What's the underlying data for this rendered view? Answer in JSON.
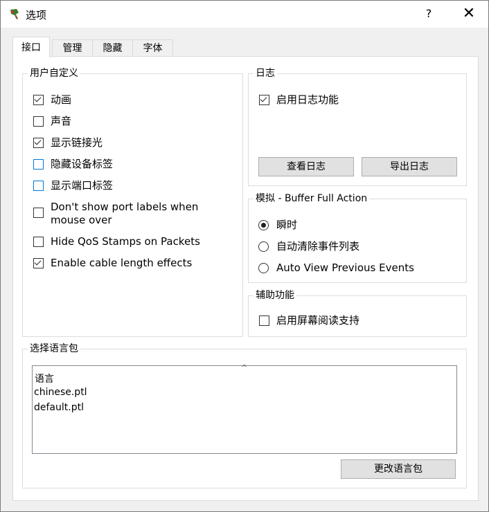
{
  "window": {
    "title": "选项",
    "help_label": "?",
    "close_label": "✕"
  },
  "tabs": [
    {
      "label": "接口",
      "active": true
    },
    {
      "label": "管理",
      "active": false
    },
    {
      "label": "隐藏",
      "active": false
    },
    {
      "label": "字体",
      "active": false
    }
  ],
  "customize": {
    "title": "用户自定义",
    "items": [
      {
        "label": "动画",
        "checked": true
      },
      {
        "label": "声音",
        "checked": false
      },
      {
        "label": "显示链接光",
        "checked": true
      },
      {
        "label": "隐藏设备标签",
        "checked": false
      },
      {
        "label": "显示端口标签",
        "checked": false
      },
      {
        "label": "Don't show port labels when mouse over",
        "checked": false
      },
      {
        "label": "Hide QoS Stamps on Packets",
        "checked": false
      },
      {
        "label": "Enable cable length effects",
        "checked": true
      }
    ]
  },
  "log": {
    "title": "日志",
    "enable_label": "启用日志功能",
    "enable_checked": true,
    "view_button": "查看日志",
    "export_button": "导出日志"
  },
  "simulation": {
    "title": "模拟 - Buffer Full Action",
    "options": [
      {
        "label": "瞬时",
        "selected": true
      },
      {
        "label": "自动清除事件列表",
        "selected": false
      },
      {
        "label": "Auto View Previous Events",
        "selected": false
      }
    ]
  },
  "accessibility": {
    "title": "辅助功能",
    "screen_reader_label": "启用屏幕阅读支持",
    "screen_reader_checked": false
  },
  "language": {
    "title": "选择语言包",
    "column_header": "语言",
    "sort_icon": "^",
    "items": [
      "chinese.ptl",
      "default.ptl"
    ],
    "change_button": "更改语言包"
  }
}
